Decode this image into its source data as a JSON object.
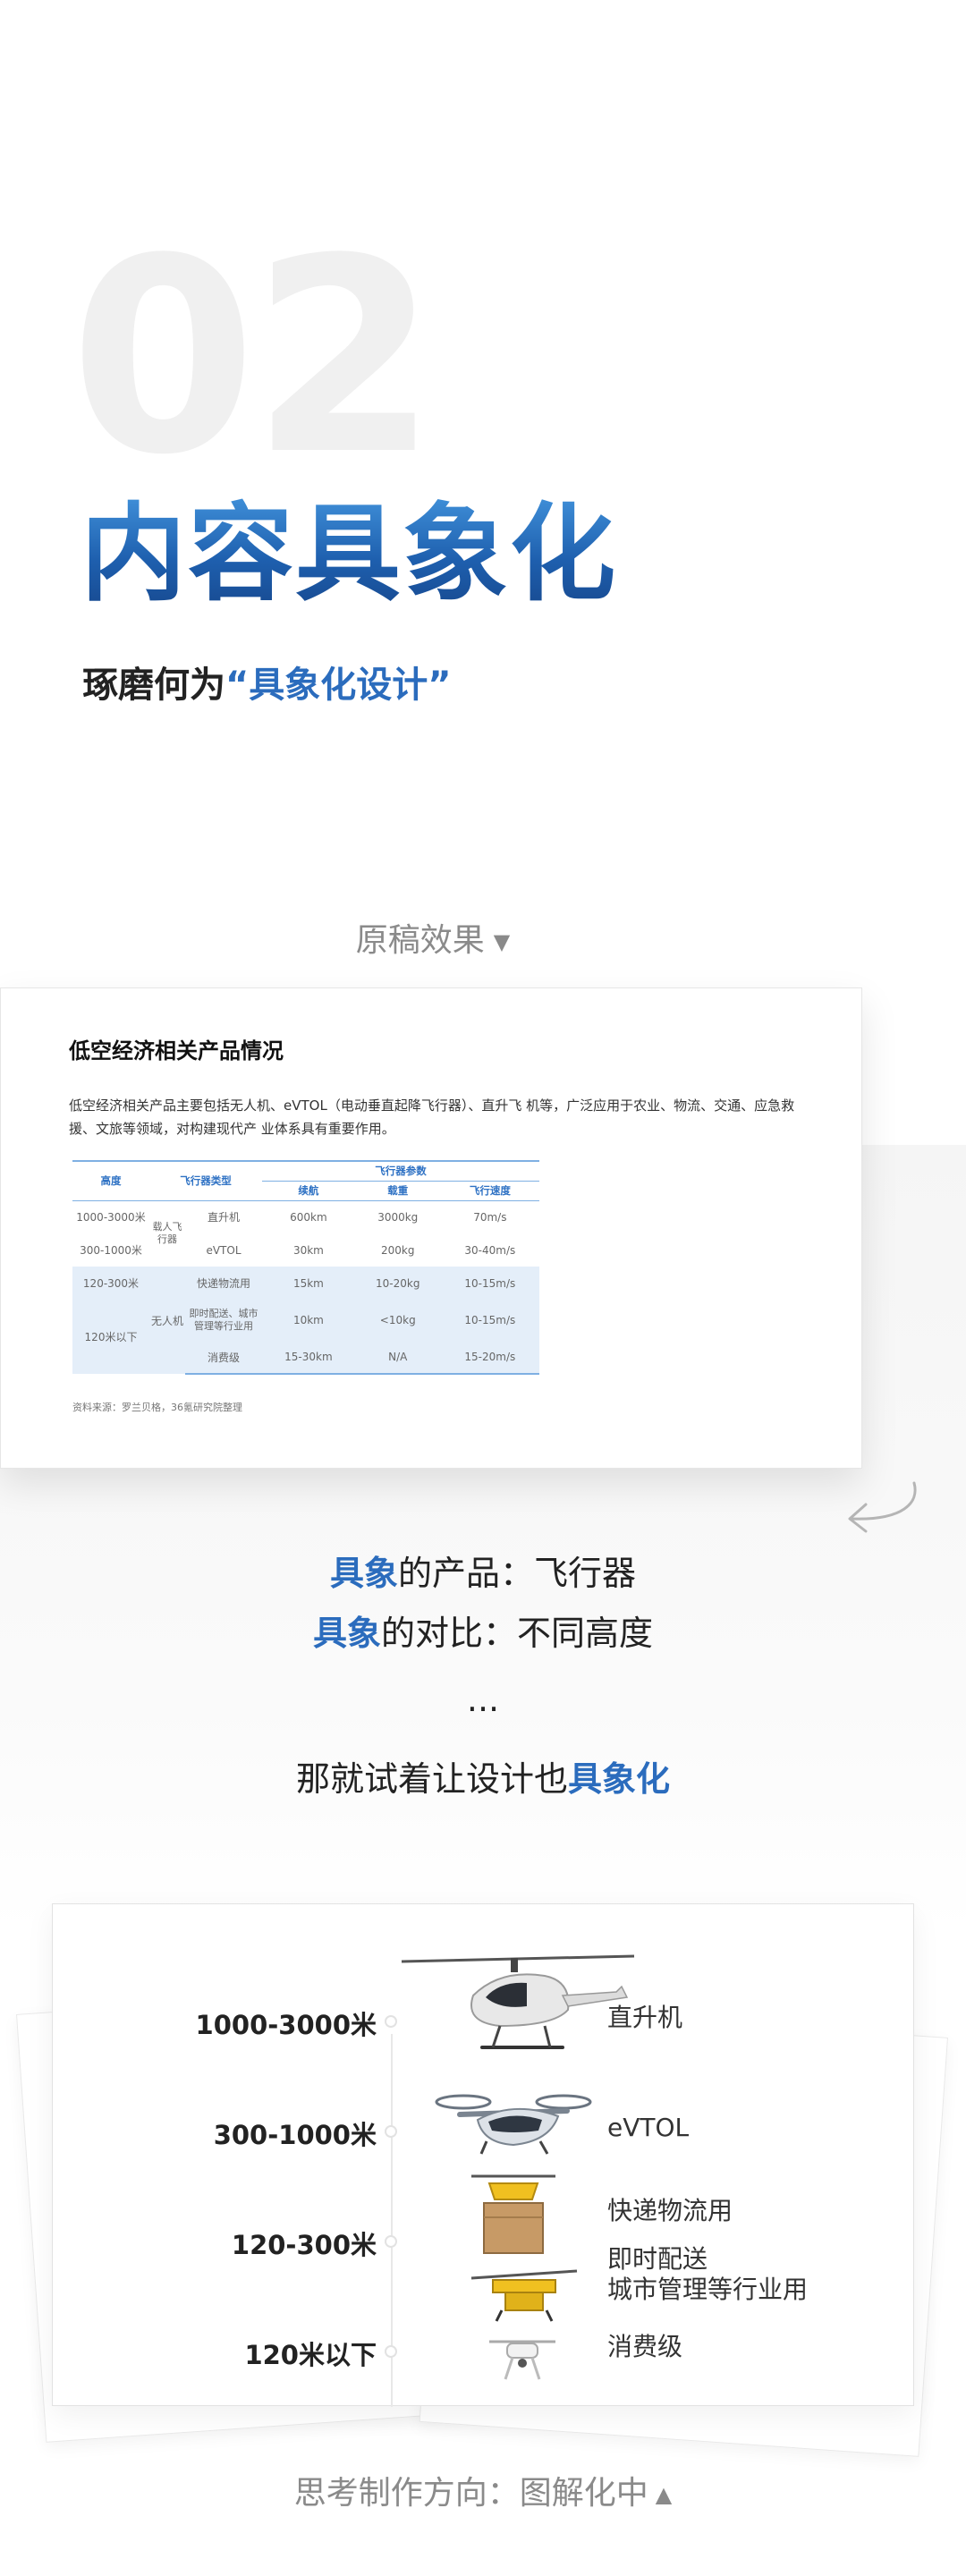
{
  "header": {
    "number": "02",
    "title": "内容具象化",
    "subtitle_prefix": "琢磨何为",
    "subtitle_highlight": "“具象化设计”"
  },
  "original": {
    "label": "原稿效果",
    "card_title": "低空经济相关产品情况",
    "card_desc": "低空经济相关产品主要包括无人机、eVTOL（电动垂直起降飞行器）、直升飞 机等，广泛应用于农业、物流、交通、应急救援、文旅等领域，对构建现代产 业体系具有重要作用。",
    "table": {
      "headers": {
        "height": "高度",
        "type": "飞行器类型",
        "params": "飞行器参数",
        "range": "续航",
        "load": "载重",
        "speed": "飞行速度"
      },
      "groups": {
        "manned": "载人飞行器",
        "unmanned": "无人机"
      },
      "rows": [
        {
          "height": "1000-3000米",
          "type": "直升机",
          "range": "600km",
          "load": "3000kg",
          "speed": "70m/s"
        },
        {
          "height": "300-1000米",
          "type": "eVTOL",
          "range": "30km",
          "load": "200kg",
          "speed": "30-40m/s"
        },
        {
          "height": "120-300米",
          "type": "快递物流用",
          "range": "15km",
          "load": "10-20kg",
          "speed": "10-15m/s"
        },
        {
          "height": "120米以下",
          "type": "即时配送、城市管理等行业用",
          "range": "10km",
          "load": "<10kg",
          "speed": "10-15m/s"
        },
        {
          "height": "",
          "type": "消费级",
          "range": "15-30km",
          "load": "N/A",
          "speed": "15-20m/s"
        }
      ]
    },
    "source": "资料来源：罗兰贝格，36氪研究院整理"
  },
  "middle": {
    "line1_b": "具象",
    "line1": "的产品：飞行器",
    "line2_b": "具象",
    "line2": "的对比：不同高度",
    "dots": "...",
    "line3": "那就试着让设计也",
    "line3_b": "具象化"
  },
  "diagram": {
    "altitudes": [
      "1000-3000米",
      "300-1000米",
      "120-300米",
      "120米以下"
    ],
    "categories": {
      "helicopter": "直升机",
      "evtol": "eVTOL",
      "logistics": "快递物流用",
      "delivery": "即时配送\n城市管理等行业用",
      "consumer": "消费级"
    }
  },
  "footer": {
    "label": "思考制作方向：图解化中"
  },
  "colors": {
    "accent_blue": "#2b6cbd",
    "highlight_yellow": "#fbefc6",
    "table_blue": "#e4eef9"
  },
  "icons": [
    "triangle-down-icon",
    "curl-arrow-icon",
    "helicopter-icon",
    "evtol-icon",
    "logistics-drone-icon",
    "delivery-drone-icon",
    "consumer-drone-icon",
    "triangle-up-icon"
  ]
}
